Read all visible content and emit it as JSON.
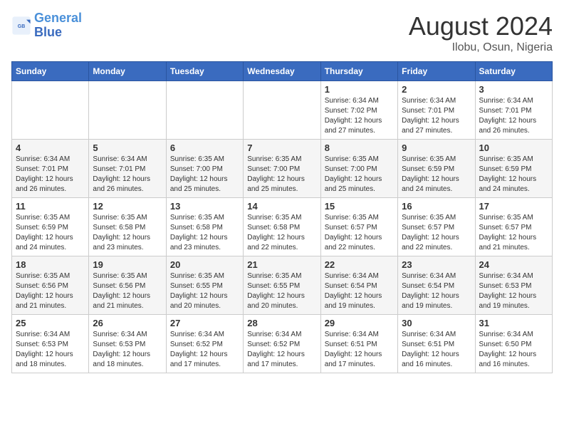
{
  "header": {
    "logo_line1": "General",
    "logo_line2": "Blue",
    "title": "August 2024",
    "subtitle": "Ilobu, Osun, Nigeria"
  },
  "weekdays": [
    "Sunday",
    "Monday",
    "Tuesday",
    "Wednesday",
    "Thursday",
    "Friday",
    "Saturday"
  ],
  "weeks": [
    [
      {
        "day": "",
        "info": ""
      },
      {
        "day": "",
        "info": ""
      },
      {
        "day": "",
        "info": ""
      },
      {
        "day": "",
        "info": ""
      },
      {
        "day": "1",
        "info": "Sunrise: 6:34 AM\nSunset: 7:02 PM\nDaylight: 12 hours\nand 27 minutes."
      },
      {
        "day": "2",
        "info": "Sunrise: 6:34 AM\nSunset: 7:01 PM\nDaylight: 12 hours\nand 27 minutes."
      },
      {
        "day": "3",
        "info": "Sunrise: 6:34 AM\nSunset: 7:01 PM\nDaylight: 12 hours\nand 26 minutes."
      }
    ],
    [
      {
        "day": "4",
        "info": "Sunrise: 6:34 AM\nSunset: 7:01 PM\nDaylight: 12 hours\nand 26 minutes."
      },
      {
        "day": "5",
        "info": "Sunrise: 6:34 AM\nSunset: 7:01 PM\nDaylight: 12 hours\nand 26 minutes."
      },
      {
        "day": "6",
        "info": "Sunrise: 6:35 AM\nSunset: 7:00 PM\nDaylight: 12 hours\nand 25 minutes."
      },
      {
        "day": "7",
        "info": "Sunrise: 6:35 AM\nSunset: 7:00 PM\nDaylight: 12 hours\nand 25 minutes."
      },
      {
        "day": "8",
        "info": "Sunrise: 6:35 AM\nSunset: 7:00 PM\nDaylight: 12 hours\nand 25 minutes."
      },
      {
        "day": "9",
        "info": "Sunrise: 6:35 AM\nSunset: 6:59 PM\nDaylight: 12 hours\nand 24 minutes."
      },
      {
        "day": "10",
        "info": "Sunrise: 6:35 AM\nSunset: 6:59 PM\nDaylight: 12 hours\nand 24 minutes."
      }
    ],
    [
      {
        "day": "11",
        "info": "Sunrise: 6:35 AM\nSunset: 6:59 PM\nDaylight: 12 hours\nand 24 minutes."
      },
      {
        "day": "12",
        "info": "Sunrise: 6:35 AM\nSunset: 6:58 PM\nDaylight: 12 hours\nand 23 minutes."
      },
      {
        "day": "13",
        "info": "Sunrise: 6:35 AM\nSunset: 6:58 PM\nDaylight: 12 hours\nand 23 minutes."
      },
      {
        "day": "14",
        "info": "Sunrise: 6:35 AM\nSunset: 6:58 PM\nDaylight: 12 hours\nand 22 minutes."
      },
      {
        "day": "15",
        "info": "Sunrise: 6:35 AM\nSunset: 6:57 PM\nDaylight: 12 hours\nand 22 minutes."
      },
      {
        "day": "16",
        "info": "Sunrise: 6:35 AM\nSunset: 6:57 PM\nDaylight: 12 hours\nand 22 minutes."
      },
      {
        "day": "17",
        "info": "Sunrise: 6:35 AM\nSunset: 6:57 PM\nDaylight: 12 hours\nand 21 minutes."
      }
    ],
    [
      {
        "day": "18",
        "info": "Sunrise: 6:35 AM\nSunset: 6:56 PM\nDaylight: 12 hours\nand 21 minutes."
      },
      {
        "day": "19",
        "info": "Sunrise: 6:35 AM\nSunset: 6:56 PM\nDaylight: 12 hours\nand 21 minutes."
      },
      {
        "day": "20",
        "info": "Sunrise: 6:35 AM\nSunset: 6:55 PM\nDaylight: 12 hours\nand 20 minutes."
      },
      {
        "day": "21",
        "info": "Sunrise: 6:35 AM\nSunset: 6:55 PM\nDaylight: 12 hours\nand 20 minutes."
      },
      {
        "day": "22",
        "info": "Sunrise: 6:34 AM\nSunset: 6:54 PM\nDaylight: 12 hours\nand 19 minutes."
      },
      {
        "day": "23",
        "info": "Sunrise: 6:34 AM\nSunset: 6:54 PM\nDaylight: 12 hours\nand 19 minutes."
      },
      {
        "day": "24",
        "info": "Sunrise: 6:34 AM\nSunset: 6:53 PM\nDaylight: 12 hours\nand 19 minutes."
      }
    ],
    [
      {
        "day": "25",
        "info": "Sunrise: 6:34 AM\nSunset: 6:53 PM\nDaylight: 12 hours\nand 18 minutes."
      },
      {
        "day": "26",
        "info": "Sunrise: 6:34 AM\nSunset: 6:53 PM\nDaylight: 12 hours\nand 18 minutes."
      },
      {
        "day": "27",
        "info": "Sunrise: 6:34 AM\nSunset: 6:52 PM\nDaylight: 12 hours\nand 17 minutes."
      },
      {
        "day": "28",
        "info": "Sunrise: 6:34 AM\nSunset: 6:52 PM\nDaylight: 12 hours\nand 17 minutes."
      },
      {
        "day": "29",
        "info": "Sunrise: 6:34 AM\nSunset: 6:51 PM\nDaylight: 12 hours\nand 17 minutes."
      },
      {
        "day": "30",
        "info": "Sunrise: 6:34 AM\nSunset: 6:51 PM\nDaylight: 12 hours\nand 16 minutes."
      },
      {
        "day": "31",
        "info": "Sunrise: 6:34 AM\nSunset: 6:50 PM\nDaylight: 12 hours\nand 16 minutes."
      }
    ]
  ]
}
